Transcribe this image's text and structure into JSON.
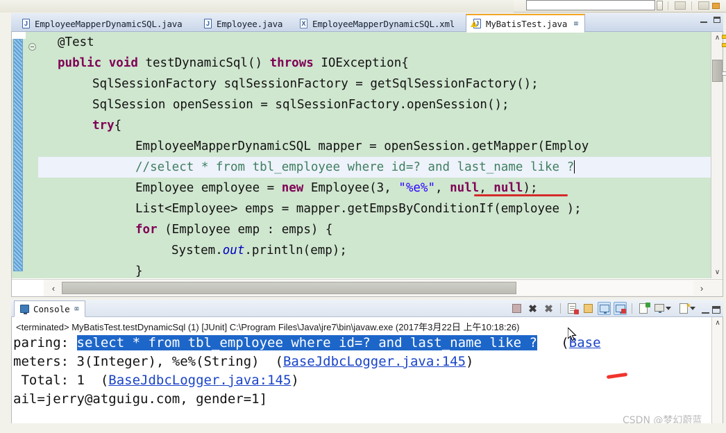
{
  "editor": {
    "tabs": [
      {
        "label": "EmployeeMapperDynamicSQL.java",
        "icon": "java-file-icon",
        "icon_letter": "J",
        "active": false,
        "closable": false
      },
      {
        "label": "Employee.java",
        "icon": "java-file-icon",
        "icon_letter": "J",
        "active": false,
        "closable": false
      },
      {
        "label": "EmployeeMapperDynamicSQL.xml",
        "icon": "xml-file-icon",
        "icon_letter": "X",
        "active": false,
        "closable": false
      },
      {
        "label": "MyBatisTest.java",
        "icon": "java-file-warning-icon",
        "icon_letter": "J",
        "active": true,
        "closable": true,
        "close_glyph": "⌧"
      }
    ],
    "window_controls": {
      "minimize": "minimize-icon",
      "maximize": "maximize-icon"
    },
    "gutter": {
      "fold_icon": "fold-collapse-icon",
      "change_bar": "change-marker-bar"
    },
    "code_lines": [
      {
        "indent": 1,
        "segments": [
          {
            "t": "@Test",
            "c": "plain"
          }
        ]
      },
      {
        "indent": 1,
        "segments": [
          {
            "t": "public",
            "c": "kw"
          },
          {
            "t": " ",
            "c": "plain"
          },
          {
            "t": "void",
            "c": "kw"
          },
          {
            "t": " testDynamicSql() ",
            "c": "plain"
          },
          {
            "t": "throws",
            "c": "kw"
          },
          {
            "t": " IOException{",
            "c": "plain"
          }
        ]
      },
      {
        "indent": 2,
        "segments": [
          {
            "t": "SqlSessionFactory sqlSessionFactory = getSqlSessionFactory();",
            "c": "plain"
          }
        ]
      },
      {
        "indent": 2,
        "segments": [
          {
            "t": "SqlSession openSession = sqlSessionFactory.openSession();",
            "c": "plain"
          }
        ]
      },
      {
        "indent": 2,
        "segments": [
          {
            "t": "try",
            "c": "kw"
          },
          {
            "t": "{",
            "c": "plain"
          }
        ]
      },
      {
        "indent": 3,
        "segments": [
          {
            "t": "EmployeeMapperDynamicSQL mapper = openSession.getMapper(Employ",
            "c": "plain"
          }
        ]
      },
      {
        "indent": 3,
        "current": true,
        "segments": [
          {
            "t": "//select * from tbl_employee where id=? and last_name like ?",
            "c": "cmt"
          },
          {
            "t": "",
            "c": "caret"
          }
        ]
      },
      {
        "indent": 3,
        "segments": [
          {
            "t": "Employee employee = ",
            "c": "plain"
          },
          {
            "t": "new",
            "c": "kw"
          },
          {
            "t": " Employee(3, ",
            "c": "plain"
          },
          {
            "t": "\"%e%\"",
            "c": "str"
          },
          {
            "t": ", ",
            "c": "plain"
          },
          {
            "t": "null",
            "c": "kw"
          },
          {
            "t": ", ",
            "c": "plain"
          },
          {
            "t": "null",
            "c": "kw"
          },
          {
            "t": ");",
            "c": "plain"
          }
        ]
      },
      {
        "indent": 3,
        "segments": [
          {
            "t": "List<Employee> emps = mapper.getEmpsByConditionIf(employee );",
            "c": "plain"
          }
        ]
      },
      {
        "indent": 3,
        "segments": [
          {
            "t": "for",
            "c": "kw"
          },
          {
            "t": " (Employee emp : emps) {",
            "c": "plain"
          }
        ]
      },
      {
        "indent": 4,
        "segments": [
          {
            "t": "System.",
            "c": "plain"
          },
          {
            "t": "out",
            "c": "fld"
          },
          {
            "t": ".println(emp);",
            "c": "plain"
          }
        ]
      },
      {
        "indent": 3,
        "segments": [
          {
            "t": "}",
            "c": "plain"
          }
        ]
      }
    ],
    "scrollbars": {
      "vertical": {
        "up_arrow": "∧",
        "down_arrow": "∨"
      },
      "horizontal": {
        "left_arrow": "‹",
        "right_arrow": "›"
      }
    }
  },
  "console": {
    "tab_label": "Console",
    "tab_close_glyph": "⌧",
    "toolbar_icons": [
      "terminate-icon",
      "remove-launch-icon",
      "remove-all-terminated-icon",
      "clear-console-icon",
      "scroll-lock-icon",
      "show-console-on-output-icon",
      "show-console-on-error-icon",
      "pin-console-icon",
      "display-selected-console-icon",
      "open-console-icon",
      "minimize-icon",
      "maximize-icon"
    ],
    "status_line": "<terminated> MyBatisTest.testDynamicSql (1) [JUnit] C:\\Program Files\\Java\\jre7\\bin\\javaw.exe (2017年3月22日 上午10:18:26)",
    "output_lines": [
      {
        "segments": [
          {
            "t": "paring: ",
            "c": "plain"
          },
          {
            "t": "select * from tbl_employee where id=? and last_name like ?",
            "c": "hl"
          },
          {
            "t": "   (",
            "c": "plain"
          },
          {
            "t": "Base",
            "c": "lnk"
          }
        ]
      },
      {
        "segments": [
          {
            "t": "meters: 3(Integer), %e%(String)  (",
            "c": "plain"
          },
          {
            "t": "BaseJdbcLogger.java:145",
            "c": "lnk"
          },
          {
            "t": ")",
            "c": "plain"
          }
        ]
      },
      {
        "segments": [
          {
            "t": " Total: 1  (",
            "c": "plain"
          },
          {
            "t": "BaseJdbcLogger.java:145",
            "c": "lnk"
          },
          {
            "t": ")",
            "c": "plain"
          }
        ]
      },
      {
        "segments": [
          {
            "t": "ail=jerry@atguigu.com, gender=1]",
            "c": "plain"
          }
        ]
      }
    ],
    "scroll_up_arrow": "∧"
  },
  "annotations": {
    "code_red_underline": "red-underline-under-null-null",
    "console_red_mark": "red-highlight-mark"
  },
  "watermark": "CSDN @梦幻蔚蓝",
  "colors": {
    "editor_background": "#cfe6cf",
    "current_line": "#eef2fb",
    "keyword": "#7f0055",
    "comment": "#3f7f5f",
    "string": "#2a00ff",
    "field": "#0000c0",
    "selection": "#1d66c9",
    "link": "#1a44c8",
    "annotation_red": "#d42a2a",
    "tab_active_top": "#f5a623"
  }
}
